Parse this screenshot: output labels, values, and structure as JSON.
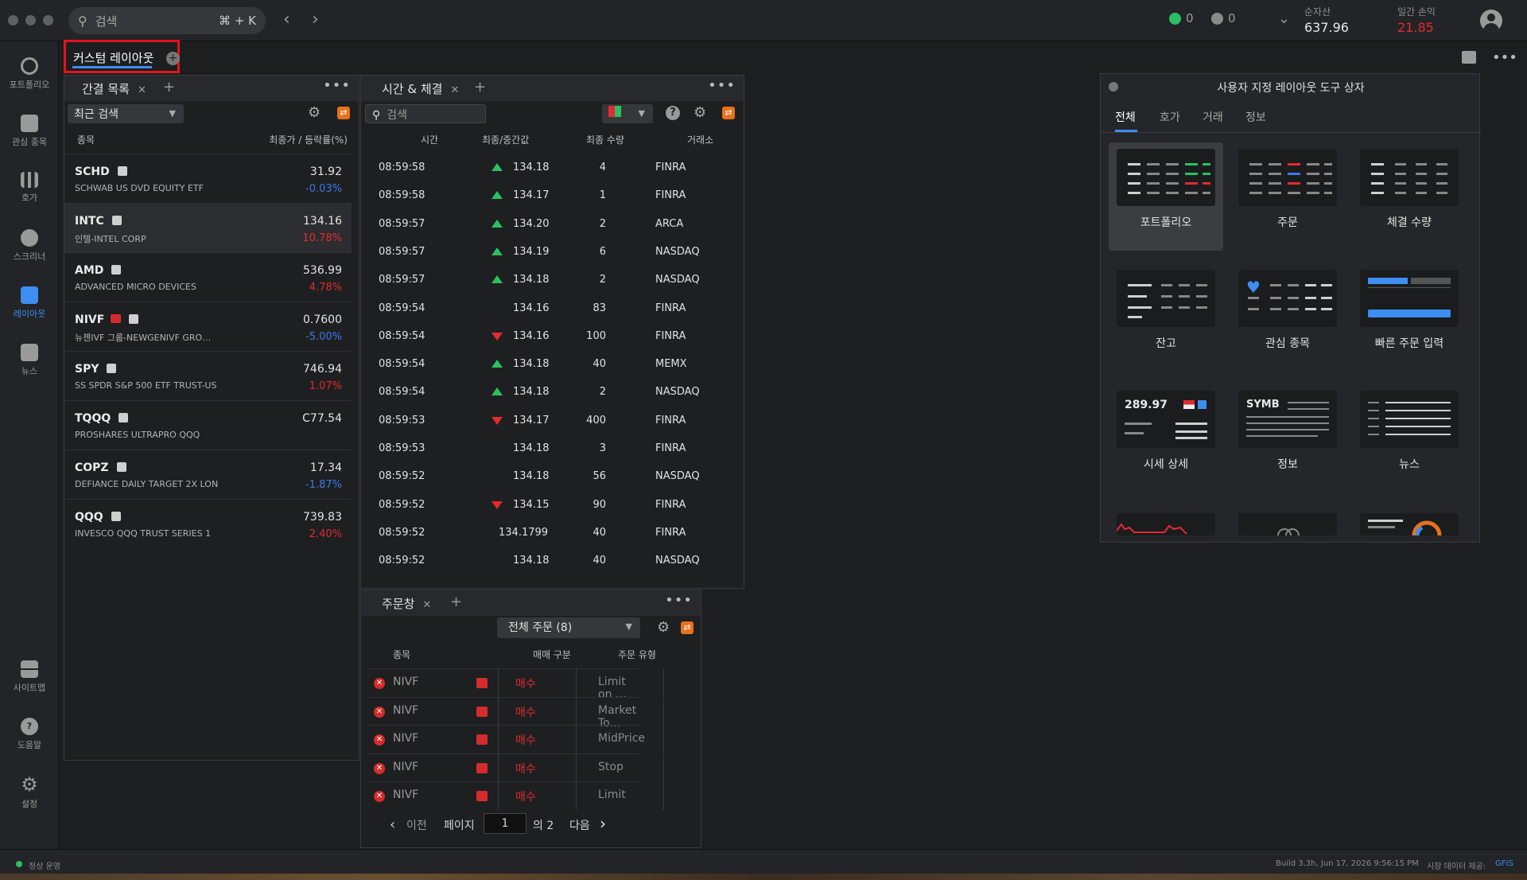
{
  "topbar": {
    "search_placeholder": "검색",
    "search_shortcut": "⌘ + K",
    "green_count": "0",
    "check_count": "0",
    "net_assets_label": "순자산",
    "net_assets_value": "637.96",
    "daily_pl_label": "일간 손익",
    "daily_pl_value": "21.85"
  },
  "sidebar": {
    "items": [
      {
        "label": "포트폴리오",
        "icon": "portfolio-icon"
      },
      {
        "label": "관심 종목",
        "icon": "watchlist-icon"
      },
      {
        "label": "호가",
        "icon": "quote-icon"
      },
      {
        "label": "스크리너",
        "icon": "screener-icon"
      },
      {
        "label": "레이아웃",
        "icon": "layout-icon"
      },
      {
        "label": "뉴스",
        "icon": "news-icon"
      },
      {
        "label": "사이트맵",
        "icon": "sitemap-icon"
      },
      {
        "label": "도움말",
        "icon": "help-icon"
      },
      {
        "label": "설정",
        "icon": "settings-icon"
      }
    ]
  },
  "main_tab": {
    "label": "커스텀 레이아웃"
  },
  "watchlist": {
    "tab_label": "간결 목록",
    "dropdown": "최근 검색",
    "col_symbol": "종목",
    "col_price": "최종가 / 등락률(%)",
    "rows": [
      {
        "sym": "SCHD",
        "name": "SCHWAB US DVD EQUITY ETF",
        "price": "31.92",
        "chg": "-0.03%",
        "dir": "dn"
      },
      {
        "sym": "INTC",
        "name": "인텔-INTEL CORP",
        "price": "134.16",
        "chg": "10.78%",
        "dir": "up"
      },
      {
        "sym": "AMD",
        "name": "ADVANCED MICRO DEVICES",
        "price": "536.99",
        "chg": "4.78%",
        "dir": "up"
      },
      {
        "sym": "NIVF",
        "name": "뉴젠IVF 그룹-NEWGENIVF GRO…",
        "price": "0.7600",
        "chg": "-5.00%",
        "dir": "dn"
      },
      {
        "sym": "SPY",
        "name": "SS SPDR S&P 500 ETF TRUST-US",
        "price": "746.94",
        "chg": "1.07%",
        "dir": "up"
      },
      {
        "sym": "TQQQ",
        "name": "PROSHARES ULTRAPRO QQQ",
        "price": "C77.54",
        "chg": "",
        "dir": ""
      },
      {
        "sym": "COPZ",
        "name": "DEFIANCE DAILY TARGET 2X LON",
        "price": "17.34",
        "chg": "-1.87%",
        "dir": "dn"
      },
      {
        "sym": "QQQ",
        "name": "INVESCO QQQ TRUST SERIES 1",
        "price": "739.83",
        "chg": "2.40%",
        "dir": "up"
      }
    ]
  },
  "timesales": {
    "tab_label": "시간 & 체결",
    "search_placeholder": "검색",
    "col_time": "시간",
    "col_price": "최종/중간값",
    "col_qty": "최종 수량",
    "col_exch": "거래소",
    "rows": [
      {
        "t": "08:59:58",
        "p": "134.18",
        "q": "4",
        "e": "FINRA",
        "d": "up"
      },
      {
        "t": "08:59:58",
        "p": "134.17",
        "q": "1",
        "e": "FINRA",
        "d": "up"
      },
      {
        "t": "08:59:57",
        "p": "134.20",
        "q": "2",
        "e": "ARCA",
        "d": "up"
      },
      {
        "t": "08:59:57",
        "p": "134.19",
        "q": "6",
        "e": "NASDAQ",
        "d": "up"
      },
      {
        "t": "08:59:57",
        "p": "134.18",
        "q": "2",
        "e": "NASDAQ",
        "d": "up"
      },
      {
        "t": "08:59:54",
        "p": "134.16",
        "q": "83",
        "e": "FINRA",
        "d": ""
      },
      {
        "t": "08:59:54",
        "p": "134.16",
        "q": "100",
        "e": "FINRA",
        "d": "dn"
      },
      {
        "t": "08:59:54",
        "p": "134.18",
        "q": "40",
        "e": "MEMX",
        "d": "up"
      },
      {
        "t": "08:59:54",
        "p": "134.18",
        "q": "2",
        "e": "NASDAQ",
        "d": "up"
      },
      {
        "t": "08:59:53",
        "p": "134.17",
        "q": "400",
        "e": "FINRA",
        "d": "dn"
      },
      {
        "t": "08:59:53",
        "p": "134.18",
        "q": "3",
        "e": "FINRA",
        "d": ""
      },
      {
        "t": "08:59:52",
        "p": "134.18",
        "q": "56",
        "e": "NASDAQ",
        "d": ""
      },
      {
        "t": "08:59:52",
        "p": "134.15",
        "q": "90",
        "e": "FINRA",
        "d": "dn"
      },
      {
        "t": "08:59:52",
        "p": "134.1799",
        "q": "40",
        "e": "FINRA",
        "d": ""
      },
      {
        "t": "08:59:52",
        "p": "134.18",
        "q": "40",
        "e": "NASDAQ",
        "d": ""
      }
    ]
  },
  "orders": {
    "tab_label": "주문창",
    "dropdown": "전체 주문 (8)",
    "col_symbol": "종목",
    "col_side": "매매 구분",
    "col_type": "주문 유형",
    "rows": [
      {
        "sym": "NIVF",
        "side": "매수",
        "type": "Limit on …"
      },
      {
        "sym": "NIVF",
        "side": "매수",
        "type": "Market To…"
      },
      {
        "sym": "NIVF",
        "side": "매수",
        "type": "MidPrice"
      },
      {
        "sym": "NIVF",
        "side": "매수",
        "type": "Stop"
      },
      {
        "sym": "NIVF",
        "side": "매수",
        "type": "Limit"
      }
    ],
    "prev": "이전",
    "page_label": "페이지",
    "page_value": "1",
    "of_total": "의 2",
    "next": "다음"
  },
  "toolbox": {
    "title": "사용자 지정 레이아웃 도구 상자",
    "tabs": [
      "전체",
      "호가",
      "거래",
      "정보"
    ],
    "tiles": [
      "포트폴리오",
      "주문",
      "체결 수량",
      "잔고",
      "관심 종목",
      "빠른 주문 입력",
      "시세 상세",
      "정보",
      "뉴스"
    ],
    "quote_thumb_price": "289.97",
    "info_thumb_symbol": "SYMB"
  },
  "statusbar": {
    "status": "정상 운영",
    "build": "Build 3.3h, Jun 17, 2026 9:56:15 PM",
    "data_label": "시장 데이터 제공:",
    "data_provider": "GFIS"
  },
  "colors": {
    "accent": "#3d8ef0",
    "up": "#e02b30",
    "down": "#3b79e8",
    "tick_up": "#2cbf60"
  }
}
